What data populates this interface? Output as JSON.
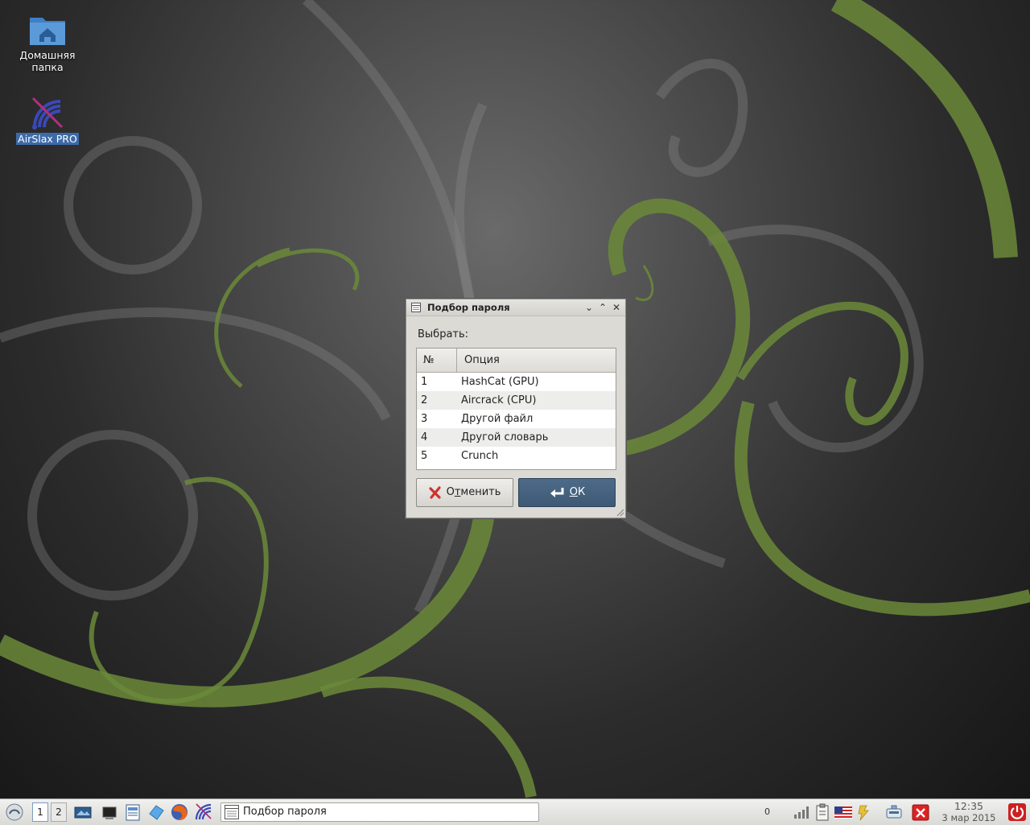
{
  "desktop": {
    "icons": [
      {
        "label": "Домашняя папка",
        "icon": "home-folder-icon"
      },
      {
        "label": "AirSlax PRO",
        "icon": "airslax-icon",
        "selected": true
      }
    ]
  },
  "dialog": {
    "title": "Подбор пароля",
    "controls": {
      "minimize": "⌄",
      "maximize": "⌃",
      "close": "✕"
    },
    "prompt": "Выбрать:",
    "table": {
      "columns": [
        "№",
        "Опция"
      ],
      "rows": [
        {
          "num": "1",
          "option": "HashCat (GPU)"
        },
        {
          "num": "2",
          "option": "Aircrack (CPU)"
        },
        {
          "num": "3",
          "option": "Другой файл"
        },
        {
          "num": "4",
          "option": "Другой словарь"
        },
        {
          "num": "5",
          "option": "Crunch"
        }
      ]
    },
    "buttons": {
      "cancel_pre": "О",
      "cancel_accel": "т",
      "cancel_post": "менить",
      "ok_accel": "О",
      "ok_post": "К"
    }
  },
  "taskbar": {
    "workspaces": [
      "1",
      "2"
    ],
    "active_workspace": "1",
    "launchers": [
      "start-menu-icon",
      "desktop-icon",
      "terminal-icon",
      "file-manager-icon",
      "network-icon",
      "firefox-icon",
      "airslax-icon"
    ],
    "task": {
      "label": "Подбор пароля"
    },
    "tray": {
      "count": "0",
      "icons": [
        "signal-icon",
        "clipboard-icon",
        "us-flag-icon",
        "power-plug-icon",
        "network-icon",
        "close-app-icon"
      ]
    },
    "clock": {
      "time": "12:35",
      "date": "3 мар 2015"
    },
    "accent": "#3d6aa8",
    "power_color": "#cc2020"
  }
}
